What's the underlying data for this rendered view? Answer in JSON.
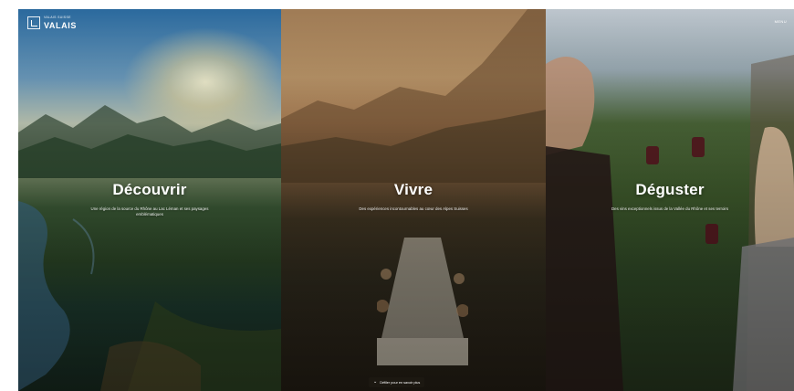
{
  "brand": {
    "small": "VALAIS SUISSE",
    "name": "VALAIS"
  },
  "menu": "MENU",
  "panels": [
    {
      "title": "Découvrir",
      "description": "Une région de la source du Rhône au Lac Léman et ses paysages emblématiques"
    },
    {
      "title": "Vivre",
      "description": "Des expériences incontournables au cœur des Alpes Suisses"
    },
    {
      "title": "Déguster",
      "description": "Des vins exceptionnels issus de la Vallée du Rhône et ses terroirs"
    }
  ],
  "scroll_hint": "Défiler pour en savoir plus",
  "icons": {
    "logo": "valais-logo-icon",
    "scroll": "chevron-down-icon"
  }
}
